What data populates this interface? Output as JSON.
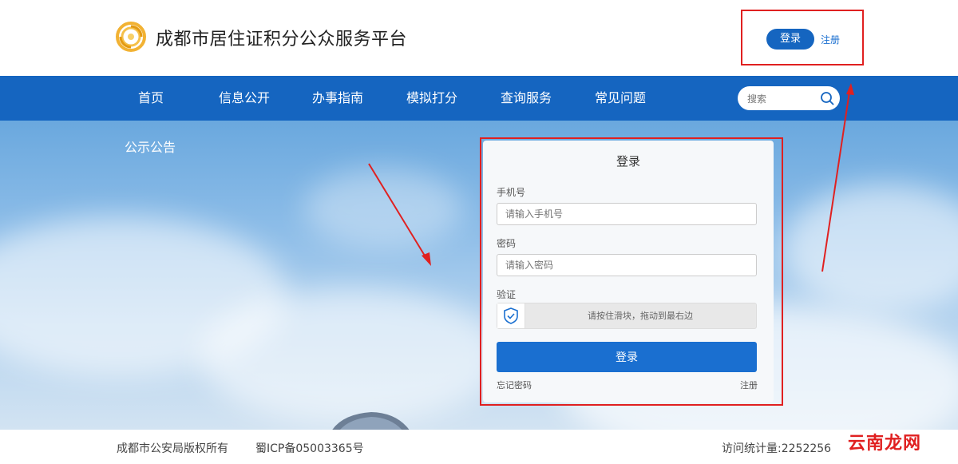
{
  "header": {
    "site_title": "成都市居住证积分公众服务平台",
    "login_label": "登录",
    "register_label": "注册"
  },
  "nav": {
    "items": [
      "首页",
      "信息公开",
      "办事指南",
      "模拟打分",
      "查询服务",
      "常见问题"
    ],
    "search_placeholder": "搜索"
  },
  "hero": {
    "notice_label": "公示公告"
  },
  "login_panel": {
    "title": "登录",
    "phone_label": "手机号",
    "phone_placeholder": "请输入手机号",
    "password_label": "密码",
    "password_placeholder": "请输入密码",
    "verify_label": "验证",
    "slider_text": "请按住滑块，拖动到最右边",
    "submit_label": "登录",
    "forgot_label": "忘记密码",
    "register_label": "注册"
  },
  "footer": {
    "copyright": "成都市公安局版权所有",
    "icp": "蜀ICP备05003365号",
    "visits": "访问统计量:2252256"
  },
  "watermark": "云南龙网",
  "colors": {
    "brand_blue": "#1565c0",
    "button_blue": "#1a6fd0",
    "annotation_red": "#e02020"
  }
}
